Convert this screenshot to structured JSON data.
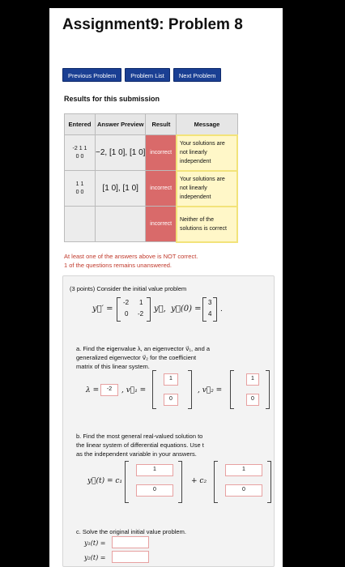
{
  "page": {
    "title": "Assignment9: Problem 8"
  },
  "nav": {
    "previous": "Previous Problem",
    "list": "Problem List",
    "next": "Next Problem"
  },
  "results": {
    "heading": "Results for this submission",
    "columns": [
      "Entered",
      "Answer Preview",
      "Result",
      "Message"
    ],
    "rows": [
      {
        "entered_top": "-2  1 1",
        "entered_bottom": "0 0",
        "preview": "−2, [1 0], [1 0]",
        "result": "incorrect",
        "message": "Your solutions are not linearly independent"
      },
      {
        "entered_top": "1 1",
        "entered_bottom": "0 0",
        "preview": "[1 0], [1 0]",
        "result": "incorrect",
        "message": "Your solutions are not linearly independent"
      },
      {
        "entered_top": "",
        "entered_bottom": "",
        "preview": "",
        "result": "incorrect",
        "message": "Neither of the solutions is correct"
      }
    ]
  },
  "warnings": {
    "line1": "At least one of the answers above is NOT correct.",
    "line2": "1 of the questions remains unanswered."
  },
  "problem": {
    "intro": "(3 points) Consider the initial value problem",
    "matrix": [
      "-2",
      "1",
      "0",
      "-2"
    ],
    "init": [
      "3",
      "4"
    ],
    "part_a_line1": "a. Find the eigenvalue λ, an eigenvector v⃗₁, and a",
    "part_a_line2": "generalized eigenvector v⃗₂ for the coefficient",
    "part_a_line3": "matrix of this linear system.",
    "lambda_value": "-2",
    "v1": [
      "1",
      "0"
    ],
    "v2": [
      "1",
      "0"
    ],
    "part_b_line1": "b. Find the most general real-valued solution to",
    "part_b_line2": "the linear system of differential equations. Use t",
    "part_b_line3": "as the independent variable in your answers.",
    "b_c1_vec": [
      "1",
      "0"
    ],
    "b_c2_vec": [
      "1",
      "0"
    ],
    "part_c": "c. Solve the original initial value problem.",
    "y1_label": "y₁(t) =",
    "y2_label": "y₂(t) ="
  }
}
